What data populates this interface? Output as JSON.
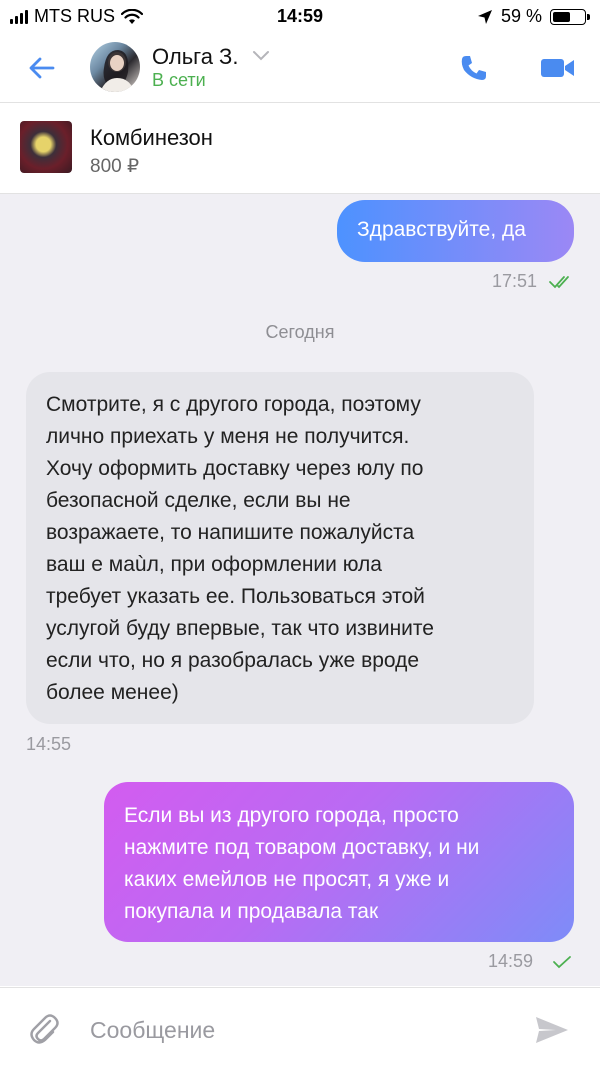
{
  "status_bar": {
    "carrier": "MTS RUS",
    "time": "14:59",
    "battery": "59 %",
    "battery_level": 0.59
  },
  "header": {
    "contact_name": "Ольга З.",
    "contact_status": "В сети",
    "accent_color": "#4a8bf0",
    "online_color": "#4cb050"
  },
  "product": {
    "title": "Комбинезон",
    "price": "800 ₽"
  },
  "messages": [
    {
      "direction": "outgoing",
      "text": "Здравствуйте, да",
      "time": "17:51",
      "status": "read"
    },
    {
      "direction": "incoming",
      "text": "Смотрите, я с другого города, поэтому\nлично приехать у меня не получится.\nХочу оформить доставку через юлу по\nбезопасной сделке, если вы не\nвозражаете, то напишите пожалуйста\nваш е маùл, при оформлении юла\nтребует указать ее. Пользоваться этой\nуслугой буду впервые, так что извините\nесли что, но я разобралась уже вроде\nболее менее)",
      "time": "14:55"
    },
    {
      "direction": "outgoing",
      "text": "Если вы из другого города, просто\nнажмите под товаром доставку, и ни\nкаких емейлов не просят, я уже и\nпокупала и продавала так",
      "time": "14:59",
      "status": "delivered"
    }
  ],
  "date_separator": "Сегодня",
  "input": {
    "placeholder": "Сообщение",
    "value": ""
  },
  "icons": [
    "back-arrow-icon",
    "chevron-down-icon",
    "phone-icon",
    "video-camera-icon",
    "double-check-icon",
    "check-icon",
    "paperclip-icon",
    "send-icon",
    "signal-icon",
    "wifi-icon",
    "location-arrow-icon",
    "battery-icon"
  ]
}
